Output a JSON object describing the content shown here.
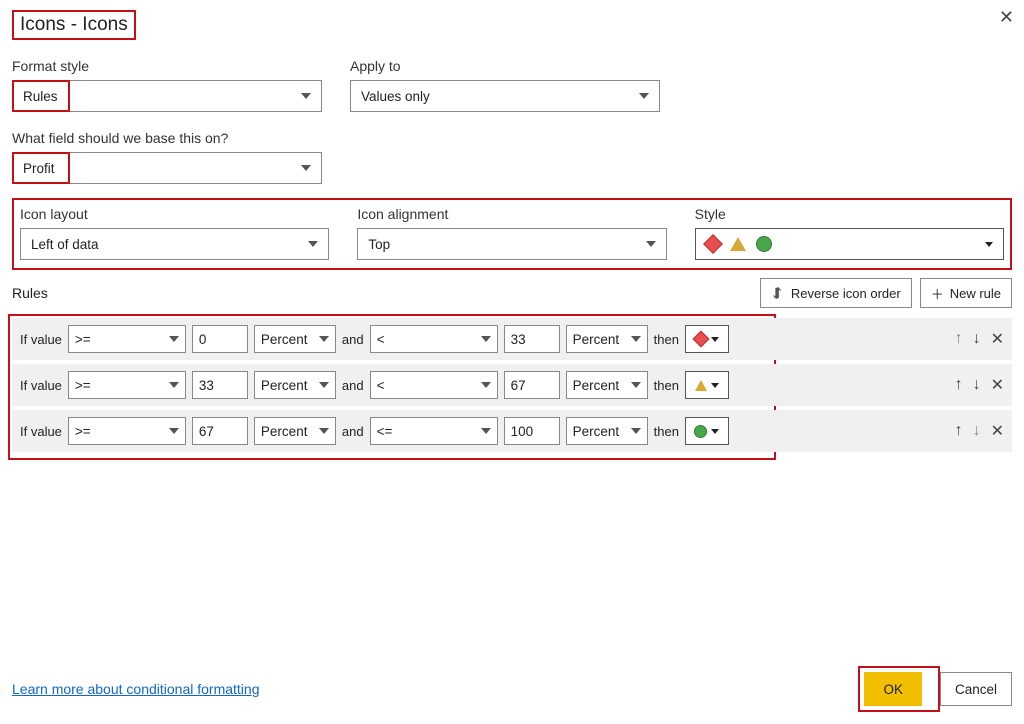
{
  "dialog_title": "Icons - Icons",
  "close_glyph": "✕",
  "format_style": {
    "label": "Format style",
    "value": "Rules"
  },
  "apply_to": {
    "label": "Apply to",
    "value": "Values only"
  },
  "base_field": {
    "label": "What field should we base this on?",
    "value": "Profit"
  },
  "icon_layout": {
    "label": "Icon layout",
    "value": "Left of data"
  },
  "icon_alignment": {
    "label": "Icon alignment",
    "value": "Top"
  },
  "style": {
    "label": "Style"
  },
  "rules_label": "Rules",
  "reverse_btn": "Reverse icon order",
  "new_rule_btn": "New rule",
  "rules": [
    {
      "if": "If value",
      "op1": ">=",
      "v1": "0",
      "u1": "Percent",
      "and": "and",
      "op2": "<",
      "v2": "33",
      "u2": "Percent",
      "then": "then",
      "icon": "diamond"
    },
    {
      "if": "If value",
      "op1": ">=",
      "v1": "33",
      "u1": "Percent",
      "and": "and",
      "op2": "<",
      "v2": "67",
      "u2": "Percent",
      "then": "then",
      "icon": "triangle"
    },
    {
      "if": "If value",
      "op1": ">=",
      "v1": "67",
      "u1": "Percent",
      "and": "and",
      "op2": "<=",
      "v2": "100",
      "u2": "Percent",
      "then": "then",
      "icon": "circle"
    }
  ],
  "learn_more": "Learn more about conditional formatting",
  "ok": "OK",
  "cancel": "Cancel",
  "icons": {
    "up": "↑",
    "down": "↓",
    "close_small": "✕",
    "plus": "＋"
  }
}
